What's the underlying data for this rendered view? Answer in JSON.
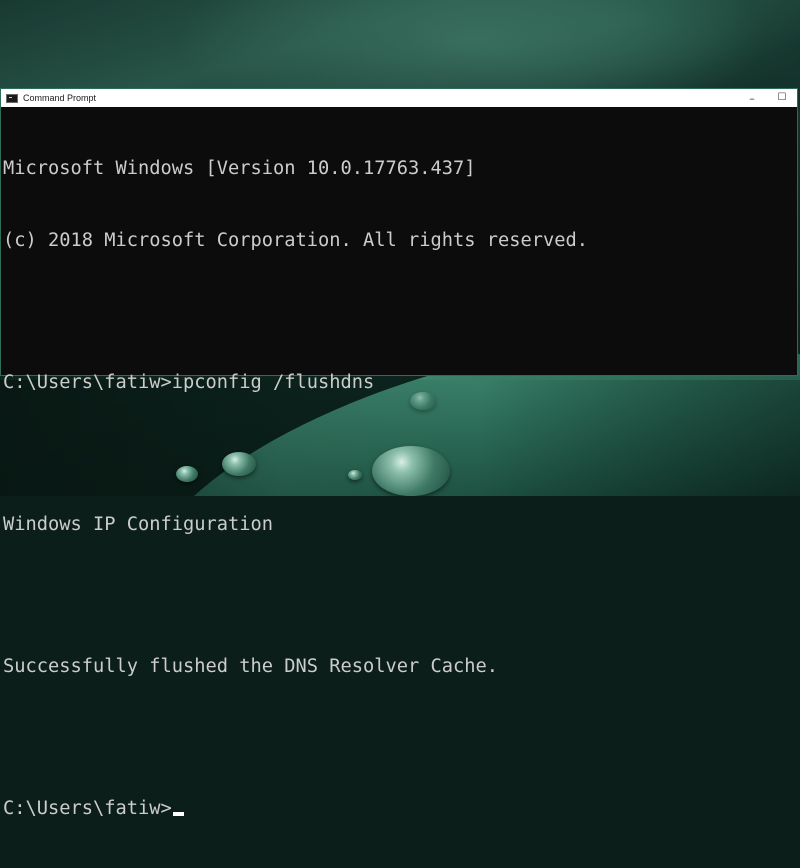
{
  "window": {
    "title": "Command Prompt",
    "controls": {
      "minimize": "–",
      "maximize": "☐"
    }
  },
  "console": {
    "lines": [
      "Microsoft Windows [Version 10.0.17763.437]",
      "(c) 2018 Microsoft Corporation. All rights reserved.",
      "",
      "C:\\Users\\fatiw>ipconfig /flushdns",
      "",
      "Windows IP Configuration",
      "",
      "Successfully flushed the DNS Resolver Cache.",
      "",
      "C:\\Users\\fatiw>"
    ]
  },
  "icons": {
    "app": "command-prompt-icon",
    "cursor": "text-cursor"
  },
  "colors": {
    "console_background": "#0c0c0c",
    "console_text": "#cccccc",
    "titlebar": "#ffffff",
    "window_border": "#2f6c57"
  }
}
